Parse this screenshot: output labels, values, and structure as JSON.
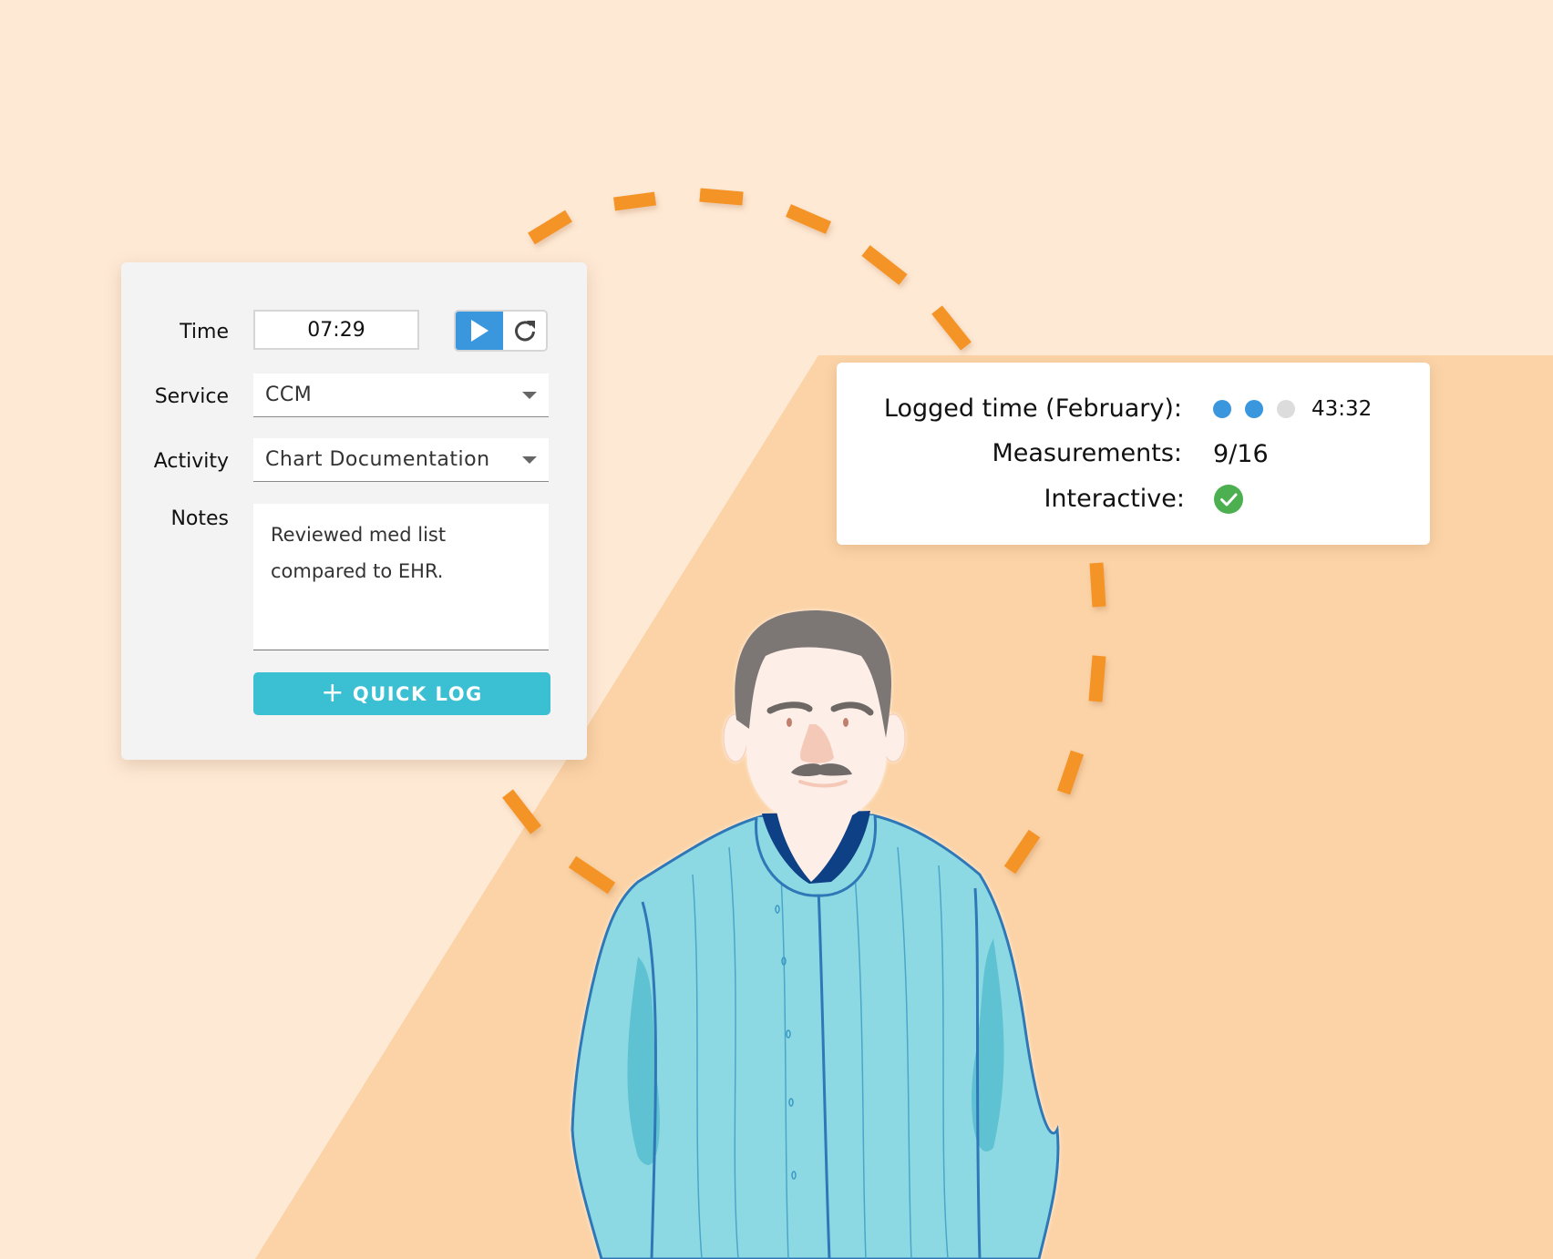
{
  "colors": {
    "background_light": "#fee9d5",
    "background_dark": "#fbd3a7",
    "dash_orange": "#f59427",
    "primary_blue": "#3a97dd",
    "teal_button": "#3bbfd2",
    "success_green": "#4caf50",
    "dot_inactive": "#dcdcdc"
  },
  "form": {
    "time_label": "Time",
    "time_value": "07:29",
    "play_icon": "play-icon",
    "reset_icon": "refresh-icon",
    "service_label": "Service",
    "service_value": "CCM",
    "activity_label": "Activity",
    "activity_value": "Chart Documentation",
    "notes_label": "Notes",
    "notes_value": "Reviewed med list\ncompared to EHR.",
    "quick_log_icon": "plus-icon",
    "quick_log_label": "QUICK LOG"
  },
  "summary": {
    "logged_time_label": "Logged time (February):",
    "logged_time_progress": {
      "filled": 2,
      "total": 3
    },
    "logged_time_value": "43:32",
    "measurements_label": "Measurements:",
    "measurements_value": "9/16",
    "interactive_label": "Interactive:",
    "interactive_icon": "check-circle-icon",
    "interactive_value": true
  },
  "illustration": {
    "subject": "elderly man with gray hair and mustache wearing a light blue cardigan"
  }
}
